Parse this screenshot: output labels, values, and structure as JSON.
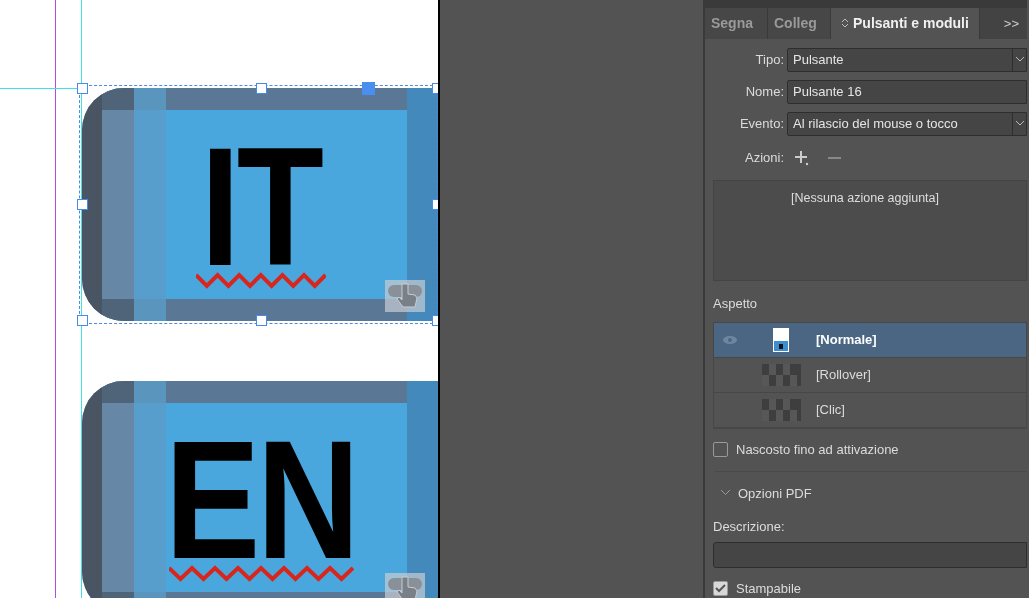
{
  "document": {
    "buttons": [
      {
        "label": "IT",
        "selected": true
      },
      {
        "label": "EN",
        "selected": false
      }
    ]
  },
  "panel": {
    "tabs": [
      {
        "label": "Segna",
        "selected": false
      },
      {
        "label": "Colleg",
        "selected": false
      },
      {
        "label": "Pulsanti e moduli",
        "selected": true
      }
    ],
    "overflow": ">>",
    "fields": [
      {
        "kind": "select",
        "label": "Tipo:",
        "value": "Pulsante"
      },
      {
        "kind": "text",
        "label": "Nome:",
        "value": "Pulsante 16"
      },
      {
        "kind": "select",
        "label": "Evento:",
        "value": "Al rilascio del mouse o tocco"
      }
    ],
    "actions_label": "Azioni:",
    "actions_empty": "[Nessuna azione aggiunta]",
    "appearance_title": "Aspetto",
    "appearances": [
      {
        "label": "[Normale]",
        "kind": "image",
        "selected": true
      },
      {
        "label": "[Rollover]",
        "kind": "empty",
        "selected": false
      },
      {
        "label": "[Clic]",
        "kind": "empty",
        "selected": false
      }
    ],
    "hidden_until_triggered": {
      "label": "Nascosto fino ad attivazione",
      "checked": false
    },
    "pdf_options": {
      "label": "Opzioni PDF",
      "expanded": true
    },
    "description_label": "Descrizione:",
    "printable": {
      "label": "Stampabile",
      "checked": true
    }
  }
}
